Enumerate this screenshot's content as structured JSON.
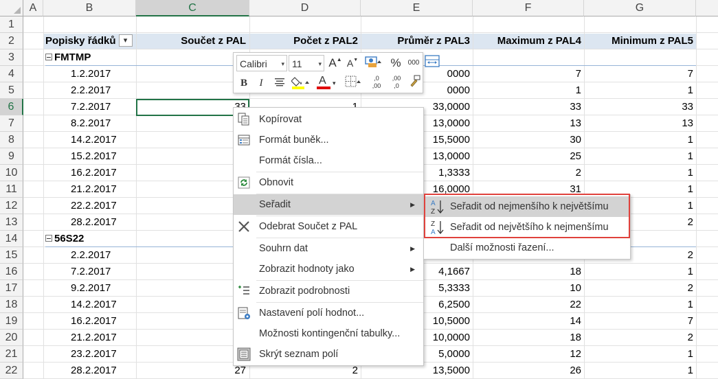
{
  "columns": [
    "A",
    "B",
    "C",
    "D",
    "E",
    "F",
    "G"
  ],
  "rows": [
    "1",
    "2",
    "3",
    "4",
    "5",
    "6",
    "7",
    "8",
    "9",
    "10",
    "11",
    "12",
    "13",
    "14",
    "15",
    "16",
    "17",
    "18",
    "19",
    "20",
    "21",
    "22"
  ],
  "pivot": {
    "header": {
      "row_labels": "Popisky řádků",
      "filter_symbol": "▾",
      "c": "Součet z PAL",
      "d": "Počet z PAL2",
      "e": "Průměr z PAL3",
      "f": "Maximum z PAL4",
      "g": "Minimum z PAL5"
    },
    "group1": "FMTMP",
    "group2": "56S22",
    "rows": [
      {
        "b": "1.2.2017",
        "e": "0000",
        "f": "7",
        "g": "7"
      },
      {
        "b": "2.2.2017",
        "e": "0000",
        "f": "1",
        "g": "1"
      },
      {
        "b": "7.2.2017",
        "c": "33",
        "d": "1",
        "e": "33,0000",
        "f": "33",
        "g": "33"
      },
      {
        "b": "8.2.2017",
        "e": "13,0000",
        "f": "13",
        "g": "13"
      },
      {
        "b": "14.2.2017",
        "e": "15,5000",
        "f": "30",
        "g": "1"
      },
      {
        "b": "15.2.2017",
        "e": "13,0000",
        "f": "25",
        "g": "1"
      },
      {
        "b": "16.2.2017",
        "e": "1,3333",
        "f": "2",
        "g": "1"
      },
      {
        "b": "21.2.2017",
        "e": "16,0000",
        "f": "31",
        "g": "1"
      },
      {
        "b": "22.2.2017",
        "e": "",
        "f": "",
        "g": "1"
      },
      {
        "b": "28.2.2017",
        "e": "",
        "f": "",
        "g": "2"
      },
      {
        "b": "2.2.2017",
        "e": "",
        "f": "",
        "g": "2"
      },
      {
        "b": "7.2.2017",
        "e": "4,1667",
        "f": "18",
        "g": "1"
      },
      {
        "b": "9.2.2017",
        "e": "5,3333",
        "f": "10",
        "g": "2"
      },
      {
        "b": "14.2.2017",
        "e": "6,2500",
        "f": "22",
        "g": "1"
      },
      {
        "b": "16.2.2017",
        "e": "10,5000",
        "f": "14",
        "g": "7"
      },
      {
        "b": "21.2.2017",
        "e": "10,0000",
        "f": "18",
        "g": "2"
      },
      {
        "b": "23.2.2017",
        "e": "5,0000",
        "f": "12",
        "g": "1"
      },
      {
        "b": "28.2.2017",
        "c": "27",
        "d": "2",
        "e": "13,5000",
        "f": "26",
        "g": "1"
      }
    ]
  },
  "minibar": {
    "font": "Calibri",
    "size": "11",
    "grow": "A",
    "shrink": "A",
    "percent": "%",
    "thousands": "000",
    "bold": "B",
    "italic": "I",
    "font_color_letter": "A",
    "inc_dec1": ",0",
    "inc_dec2": ",00",
    "inc_dec3": ",00",
    "inc_dec4": ",0"
  },
  "context_menu": [
    {
      "label": "Kopírovat",
      "icon": "copy-icon"
    },
    {
      "label": "Formát buněk...",
      "icon": "format-cells-icon"
    },
    {
      "label": "Formát čísla...",
      "icon": ""
    },
    {
      "label": "Obnovit",
      "icon": "refresh-icon"
    },
    {
      "label": "Seřadit",
      "icon": "",
      "submenu": true,
      "highlighted": true
    },
    {
      "label": "Odebrat Součet z PAL",
      "icon": "remove-icon"
    },
    {
      "label": "Souhrn dat",
      "icon": "",
      "submenu": true
    },
    {
      "label": "Zobrazit hodnoty jako",
      "icon": "",
      "submenu": true
    },
    {
      "label": "Zobrazit podrobnosti",
      "icon": "show-details-icon"
    },
    {
      "label": "Nastavení polí hodnot...",
      "icon": "field-settings-icon"
    },
    {
      "label": "Možnosti kontingenční tabulky...",
      "icon": ""
    },
    {
      "label": "Skrýt seznam polí",
      "icon": "field-list-icon"
    }
  ],
  "submenu": [
    {
      "label": "Seřadit od nejmenšího k největšímu",
      "icon": "sort-ascending-icon",
      "highlighted": true
    },
    {
      "label": "Seřadit od největšího k nejmenšímu",
      "icon": "sort-descending-icon"
    },
    {
      "label": "Další možnosti řazení...",
      "icon": ""
    }
  ],
  "sort_icon_letters": {
    "a": "A",
    "z": "Z"
  },
  "arrow_symbol": "▶",
  "caret_symbol": "▾",
  "colors": {
    "excel_green": "#217346",
    "header_band": "#dce6f1",
    "highlight_box": "#e0413c",
    "menu_highlight": "#d3d3d3"
  }
}
